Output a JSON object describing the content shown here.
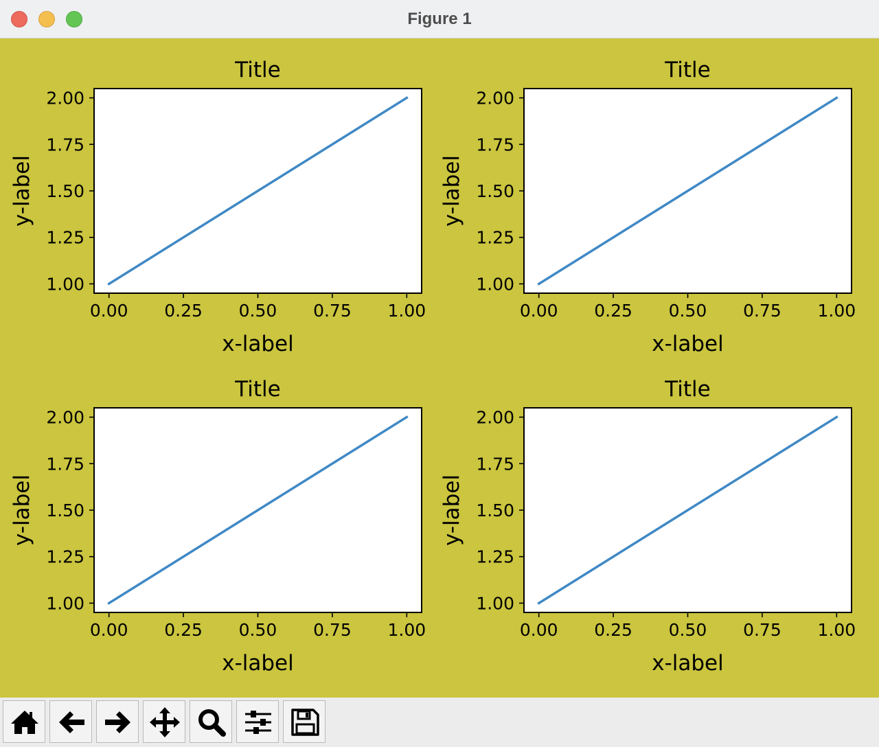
{
  "window": {
    "title": "Figure 1"
  },
  "colors": {
    "figure_bg": "#cbc53f",
    "axes_bg": "#ffffff",
    "line": "#3f88c5"
  },
  "toolbar": {
    "buttons": [
      {
        "name": "home-button",
        "icon": "home-icon"
      },
      {
        "name": "back-button",
        "icon": "left-arrow-icon"
      },
      {
        "name": "forward-button",
        "icon": "right-arrow-icon"
      },
      {
        "name": "pan-button",
        "icon": "move-icon"
      },
      {
        "name": "zoom-button",
        "icon": "magnifier-icon"
      },
      {
        "name": "configure-subplots-button",
        "icon": "sliders-icon"
      },
      {
        "name": "save-button",
        "icon": "floppy-disk-icon"
      }
    ]
  },
  "chart_data": [
    {
      "type": "line",
      "title": "Title",
      "xlabel": "x-label",
      "ylabel": "y-label",
      "xlim": [
        -0.05,
        1.05
      ],
      "ylim": [
        0.95,
        2.05
      ],
      "xticks": [
        "0.00",
        "0.25",
        "0.50",
        "0.75",
        "1.00"
      ],
      "yticks": [
        "1.00",
        "1.25",
        "1.50",
        "1.75",
        "2.00"
      ],
      "grid": false,
      "series": [
        {
          "x": [
            0,
            1
          ],
          "y": [
            1,
            2
          ]
        }
      ]
    },
    {
      "type": "line",
      "title": "Title",
      "xlabel": "x-label",
      "ylabel": "y-label",
      "xlim": [
        -0.05,
        1.05
      ],
      "ylim": [
        0.95,
        2.05
      ],
      "xticks": [
        "0.00",
        "0.25",
        "0.50",
        "0.75",
        "1.00"
      ],
      "yticks": [
        "1.00",
        "1.25",
        "1.50",
        "1.75",
        "2.00"
      ],
      "grid": false,
      "series": [
        {
          "x": [
            0,
            1
          ],
          "y": [
            1,
            2
          ]
        }
      ]
    },
    {
      "type": "line",
      "title": "Title",
      "xlabel": "x-label",
      "ylabel": "y-label",
      "xlim": [
        -0.05,
        1.05
      ],
      "ylim": [
        0.95,
        2.05
      ],
      "xticks": [
        "0.00",
        "0.25",
        "0.50",
        "0.75",
        "1.00"
      ],
      "yticks": [
        "1.00",
        "1.25",
        "1.50",
        "1.75",
        "2.00"
      ],
      "grid": false,
      "series": [
        {
          "x": [
            0,
            1
          ],
          "y": [
            1,
            2
          ]
        }
      ]
    },
    {
      "type": "line",
      "title": "Title",
      "xlabel": "x-label",
      "ylabel": "y-label",
      "xlim": [
        -0.05,
        1.05
      ],
      "ylim": [
        0.95,
        2.05
      ],
      "xticks": [
        "0.00",
        "0.25",
        "0.50",
        "0.75",
        "1.00"
      ],
      "yticks": [
        "1.00",
        "1.25",
        "1.50",
        "1.75",
        "2.00"
      ],
      "grid": false,
      "series": [
        {
          "x": [
            0,
            1
          ],
          "y": [
            1,
            2
          ]
        }
      ]
    }
  ]
}
